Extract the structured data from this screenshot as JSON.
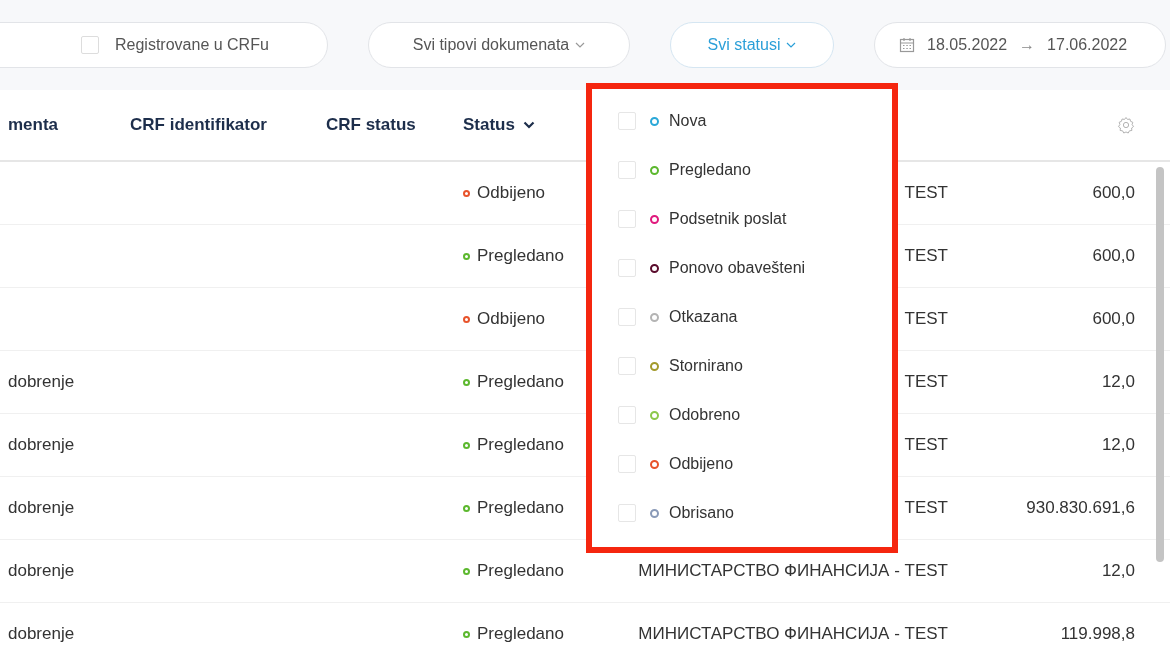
{
  "filters": {
    "registered": {
      "label": "Registrovane u CRFu",
      "checked": false
    },
    "document_type": {
      "label": "Svi tipovi dokumenata"
    },
    "status": {
      "label": "Svi statusi",
      "open": true,
      "highlighted": true,
      "options": [
        {
          "label": "Nova",
          "color": "#2aa8d8",
          "checked": false
        },
        {
          "label": "Pregledano",
          "color": "#5cb82e",
          "checked": false
        },
        {
          "label": "Podsetnik poslat",
          "color": "#e0197d",
          "checked": false
        },
        {
          "label": "Ponovo obavešteni",
          "color": "#5a0b2c",
          "checked": false
        },
        {
          "label": "Otkazana",
          "color": "#b4b4b4",
          "checked": false
        },
        {
          "label": "Stornirano",
          "color": "#a39a2c",
          "checked": false
        },
        {
          "label": "Odobreno",
          "color": "#8cc84b",
          "checked": false
        },
        {
          "label": "Odbijeno",
          "color": "#e8532b",
          "checked": false
        },
        {
          "label": "Obrisano",
          "color": "#8a9ab8",
          "checked": false
        }
      ]
    },
    "date_range": {
      "from": "18.05.2022",
      "arrow": "→",
      "to": "17.06.2022"
    }
  },
  "table": {
    "columns": [
      {
        "label": "menta",
        "has_menu": false
      },
      {
        "label": "CRF identifikator",
        "has_menu": false
      },
      {
        "label": "CRF status",
        "has_menu": false
      },
      {
        "label": "Status",
        "has_menu": true
      }
    ],
    "rows": [
      {
        "status": {
          "label": "Odbijeno",
          "color": "#e8532b"
        },
        "column_5": "TEST",
        "column_6": "600,0"
      },
      {
        "status": {
          "label": "Pregledano",
          "color": "#5cb82e"
        },
        "column_5": "TEST",
        "column_6": "600,0"
      },
      {
        "status": {
          "label": "Odbijeno",
          "color": "#e8532b"
        },
        "column_5": "TEST",
        "column_6": "600,0"
      },
      {
        "column_1": "dobrenje",
        "status": {
          "label": "Pregledano",
          "color": "#5cb82e"
        },
        "column_5": "TEST",
        "column_6": "12,0"
      },
      {
        "column_1": "dobrenje",
        "status": {
          "label": "Pregledano",
          "color": "#5cb82e"
        },
        "column_5": "TEST",
        "column_6": "12,0"
      },
      {
        "column_1": "dobrenje",
        "status": {
          "label": "Pregledano",
          "color": "#5cb82e"
        },
        "column_5": "TEST",
        "column_6": "930.830.691,6"
      },
      {
        "column_1": "dobrenje",
        "status": {
          "label": "Pregledano",
          "color": "#5cb82e"
        },
        "column_5": "МИНИСТАРСТВО ФИНАНСИЈА - TEST",
        "column_6": "12,0"
      },
      {
        "column_1": "dobrenje",
        "status": {
          "label": "Pregledano",
          "color": "#5cb82e"
        },
        "column_5": "МИНИСТАРСТВО ФИНАНСИЈА - TEST",
        "column_6": "119.998,8"
      }
    ]
  }
}
